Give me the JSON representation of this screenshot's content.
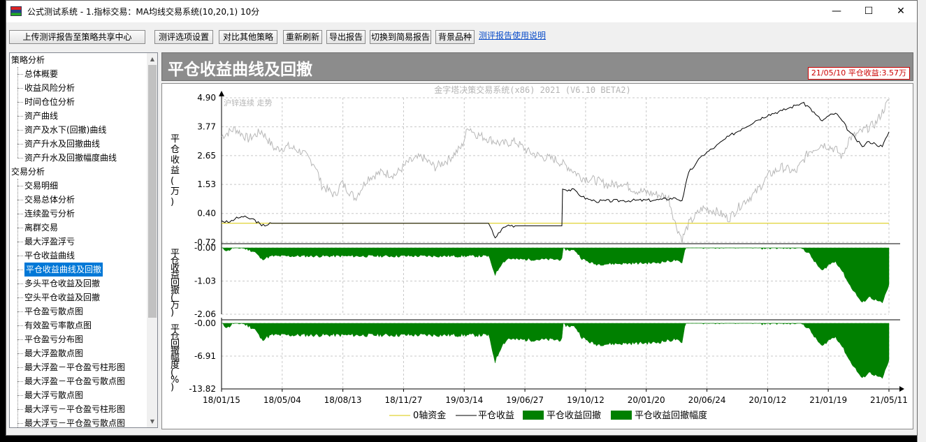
{
  "window": {
    "title": "公式测试系统 - 1.指标交易：MA均线交易系统(10,20,1) 10分",
    "minimize_glyph": "—",
    "maximize_glyph": "☐",
    "close_glyph": "✕"
  },
  "toolbar": {
    "upload_label": "上传测评报告至策略共享中心",
    "options_label": "测评选项设置",
    "compare_label": "对比其他策略",
    "refresh_label": "重新刷新",
    "export_label": "导出报告",
    "simple_label": "切换到简易报告",
    "background_label": "背景品种",
    "help_link": "测评报告使用说明"
  },
  "tree": {
    "group1": "策略分析",
    "group1_items": [
      "总体概要",
      "收益风险分析",
      "时间仓位分析",
      "资产曲线",
      "资产及水下(回撤)曲线",
      "资产升水及回撤曲线",
      "资产升水及回撤幅度曲线"
    ],
    "group2": "交易分析",
    "group2_items": [
      "交易明细",
      "交易总体分析",
      "连续盈亏分析",
      "离群交易",
      "最大浮盈浮亏",
      "平仓收益曲线",
      "平仓收益曲线及回撤",
      "多头平仓收益及回撤",
      "空头平仓收益及回撤",
      "平仓盈亏散点图",
      "有效盈亏率散点图",
      "平仓盈亏分布图",
      "最大浮盈散点图",
      "最大浮盈－平仓盈亏柱形图",
      "最大浮盈－平仓盈亏散点图",
      "最大浮亏散点图",
      "最大浮亏－平仓盈亏柱形图",
      "最大浮亏－平仓盈亏散点图"
    ],
    "selected": "平仓收益曲线及回撤"
  },
  "panel": {
    "title": "平仓收益曲线及回撤",
    "status": "21/05/10 平仓收益:3.57万"
  },
  "chart_data": {
    "type": "line",
    "title": "金字塔决策交易系统(x86) 2021 (V6.10 BETA2)",
    "background_series_label": "沪锌连续 走势",
    "x_ticks": [
      "18/01/15",
      "18/05/04",
      "18/08/13",
      "18/11/27",
      "19/03/14",
      "19/06/27",
      "19/10/12",
      "20/01/20",
      "20/06/24",
      "20/10/12",
      "21/01/19",
      "21/05/11"
    ],
    "panes": [
      {
        "ylabel": "平仓收益(万)",
        "y_ticks": [
          "4.90",
          "3.77",
          "2.65",
          "1.53",
          "0.40",
          "-0.72"
        ],
        "ylim": [
          -0.72,
          4.9
        ]
      },
      {
        "ylabel": "平仓收益回撤(万)",
        "y_ticks": [
          "-0.00",
          "-1.03",
          "-2.06"
        ],
        "ylim": [
          -2.06,
          0
        ]
      },
      {
        "ylabel": "平仓回撤幅度(%)",
        "y_ticks": [
          "-0.00",
          "-6.91",
          "-13.82"
        ],
        "ylim": [
          -13.82,
          0
        ]
      }
    ],
    "series": [
      {
        "name": "0轴资金",
        "color": "#d8c800"
      },
      {
        "name": "平仓收益",
        "color": "#000000"
      },
      {
        "name": "平仓收益回撤",
        "color": "#008000"
      },
      {
        "name": "平仓收益回撤幅度",
        "color": "#008000"
      }
    ],
    "equity_points": [
      [
        0,
        0.12
      ],
      [
        0.01,
        0.05
      ],
      [
        0.02,
        0.18
      ],
      [
        0.03,
        0.28
      ],
      [
        0.04,
        0.22
      ],
      [
        0.05,
        0.15
      ],
      [
        0.06,
        -0.08
      ],
      [
        0.075,
        0.02
      ],
      [
        0.09,
        0.02
      ],
      [
        0.2,
        0.02
      ],
      [
        0.3,
        0.02
      ],
      [
        0.4,
        0.02
      ],
      [
        0.41,
        -0.55
      ],
      [
        0.42,
        -0.2
      ],
      [
        0.43,
        -0.05
      ],
      [
        0.44,
        -0.08
      ],
      [
        0.51,
        -0.08
      ],
      [
        0.511,
        1.35
      ],
      [
        0.53,
        1.3
      ],
      [
        0.54,
        1.05
      ],
      [
        0.55,
        0.95
      ],
      [
        0.56,
        0.88
      ],
      [
        0.6,
        0.9
      ],
      [
        0.65,
        0.92
      ],
      [
        0.66,
        0.95
      ],
      [
        0.68,
        1.0
      ],
      [
        0.69,
        0.9
      ],
      [
        0.7,
        2.0
      ],
      [
        0.71,
        2.3
      ],
      [
        0.72,
        2.65
      ],
      [
        0.74,
        3.0
      ],
      [
        0.76,
        3.4
      ],
      [
        0.78,
        3.7
      ],
      [
        0.8,
        4.0
      ],
      [
        0.82,
        4.25
      ],
      [
        0.84,
        4.4
      ],
      [
        0.85,
        4.5
      ],
      [
        0.86,
        4.6
      ],
      [
        0.87,
        4.7
      ],
      [
        0.88,
        4.55
      ],
      [
        0.89,
        4.25
      ],
      [
        0.9,
        4.0
      ],
      [
        0.91,
        4.2
      ],
      [
        0.92,
        4.3
      ],
      [
        0.93,
        4.0
      ],
      [
        0.94,
        3.6
      ],
      [
        0.95,
        3.3
      ],
      [
        0.96,
        3.0
      ],
      [
        0.97,
        3.2
      ],
      [
        0.98,
        3.1
      ],
      [
        0.99,
        3.0
      ],
      [
        1.0,
        3.57
      ]
    ],
    "background_points": [
      [
        0,
        3.4
      ],
      [
        0.02,
        3.7
      ],
      [
        0.04,
        3.3
      ],
      [
        0.06,
        3.6
      ],
      [
        0.08,
        2.9
      ],
      [
        0.1,
        3.0
      ],
      [
        0.12,
        2.8
      ],
      [
        0.14,
        2.3
      ],
      [
        0.15,
        1.5
      ],
      [
        0.17,
        1.1
      ],
      [
        0.18,
        1.6
      ],
      [
        0.2,
        1.0
      ],
      [
        0.22,
        1.8
      ],
      [
        0.24,
        2.0
      ],
      [
        0.26,
        1.9
      ],
      [
        0.28,
        2.4
      ],
      [
        0.3,
        2.6
      ],
      [
        0.32,
        2.2
      ],
      [
        0.34,
        2.5
      ],
      [
        0.36,
        3.0
      ],
      [
        0.37,
        3.8
      ],
      [
        0.38,
        3.5
      ],
      [
        0.4,
        3.3
      ],
      [
        0.42,
        3.1
      ],
      [
        0.44,
        3.2
      ],
      [
        0.46,
        2.8
      ],
      [
        0.48,
        2.6
      ],
      [
        0.5,
        2.5
      ],
      [
        0.52,
        2.2
      ],
      [
        0.54,
        1.8
      ],
      [
        0.56,
        1.7
      ],
      [
        0.58,
        1.5
      ],
      [
        0.6,
        1.6
      ],
      [
        0.62,
        1.3
      ],
      [
        0.64,
        1.2
      ],
      [
        0.66,
        1.1
      ],
      [
        0.67,
        1.0
      ],
      [
        0.68,
        0.0
      ],
      [
        0.69,
        -0.6
      ],
      [
        0.7,
        0.0
      ],
      [
        0.72,
        0.6
      ],
      [
        0.74,
        0.5
      ],
      [
        0.76,
        0.2
      ],
      [
        0.78,
        0.8
      ],
      [
        0.8,
        1.2
      ],
      [
        0.82,
        1.9
      ],
      [
        0.84,
        2.2
      ],
      [
        0.86,
        2.0
      ],
      [
        0.88,
        2.8
      ],
      [
        0.9,
        3.1
      ],
      [
        0.92,
        2.9
      ],
      [
        0.93,
        2.6
      ],
      [
        0.94,
        3.3
      ],
      [
        0.96,
        3.6
      ],
      [
        0.98,
        3.9
      ],
      [
        1.0,
        4.8
      ]
    ]
  },
  "legend": {
    "zero_axis": "0轴资金",
    "equity": "平仓收益",
    "drawdown": "平仓收益回撤",
    "drawdown_pct": "平仓收益回撤幅度"
  }
}
